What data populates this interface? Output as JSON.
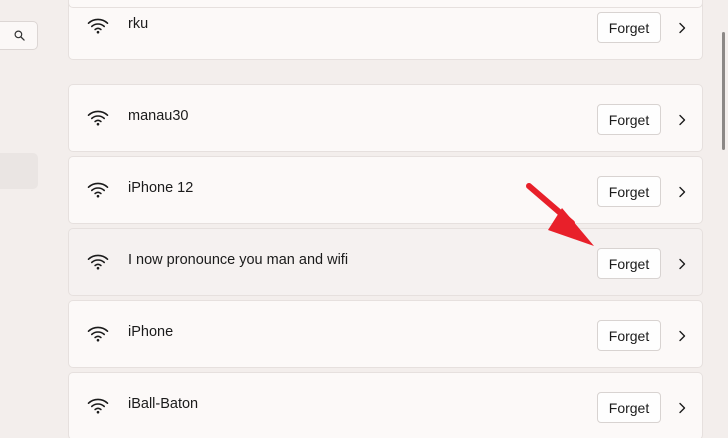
{
  "sidebar": {
    "search_icon": "search-icon"
  },
  "networks": [
    {
      "name": "rku",
      "forget_label": "Forget"
    },
    {
      "name": "manau30",
      "forget_label": "Forget"
    },
    {
      "name": "iPhone 12",
      "forget_label": "Forget"
    },
    {
      "name": "I now pronounce you man and wifi",
      "forget_label": "Forget"
    },
    {
      "name": "iPhone",
      "forget_label": "Forget"
    },
    {
      "name": "iBall-Baton",
      "forget_label": "Forget"
    }
  ],
  "colors": {
    "background": "#f3eeec",
    "card": "#fcf9f8",
    "annotation_arrow": "#e8202a"
  }
}
